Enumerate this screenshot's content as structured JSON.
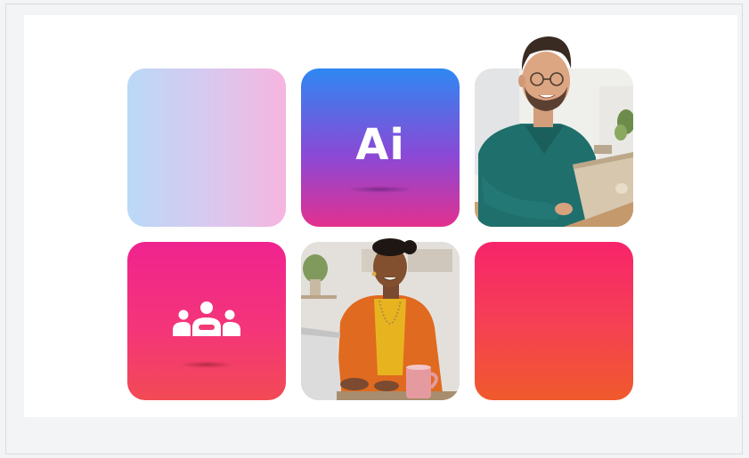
{
  "tiles": [
    {
      "name": "gradient-tile",
      "colors": [
        "#bad9f7",
        "#f6b5df"
      ]
    },
    {
      "name": "ai-logo-tile",
      "logo_text": "Ai",
      "colors": [
        "#2e88f2",
        "#e3308f"
      ]
    },
    {
      "name": "man-laptop-photo-tile"
    },
    {
      "name": "people-icon-tile",
      "icon": "people-group-icon",
      "colors": [
        "#f0238f",
        "#f24a55"
      ]
    },
    {
      "name": "woman-laptop-photo-tile"
    },
    {
      "name": "orange-gradient-tile",
      "colors": [
        "#f7246b",
        "#f05a2c"
      ]
    }
  ]
}
